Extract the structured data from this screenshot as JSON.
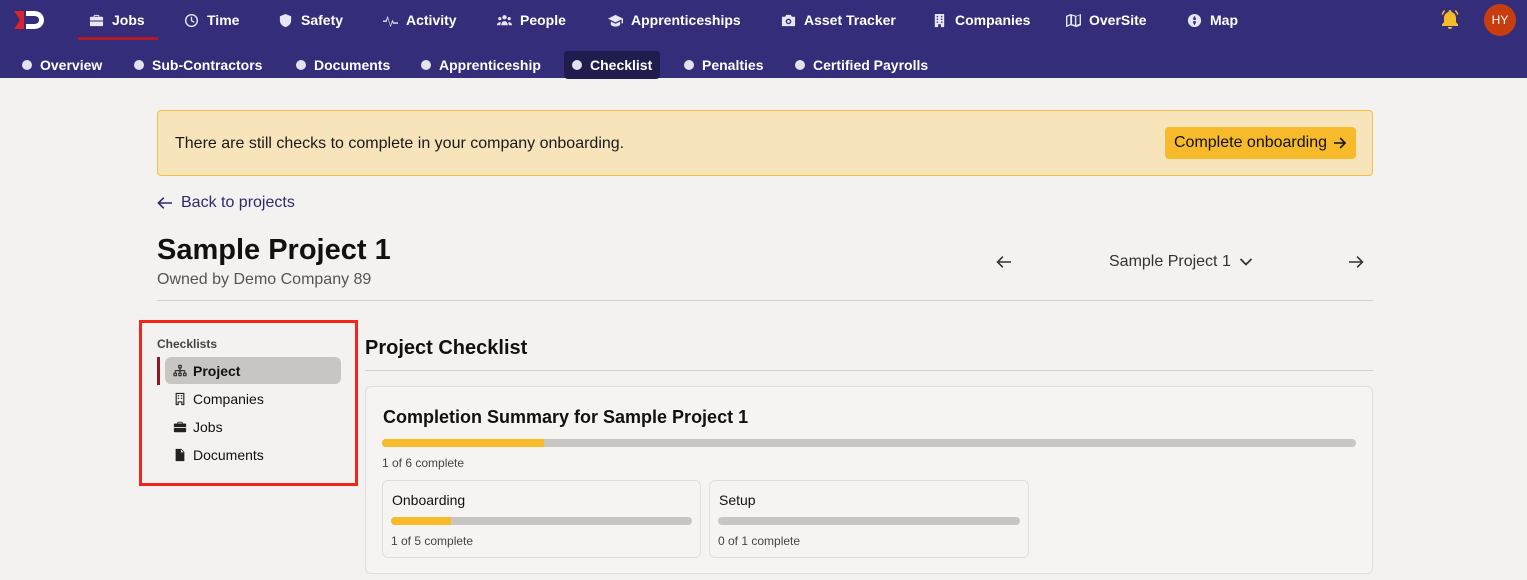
{
  "nav": {
    "items": [
      {
        "label": "Jobs",
        "icon": "briefcase-icon"
      },
      {
        "label": "Time",
        "icon": "clock-icon"
      },
      {
        "label": "Safety",
        "icon": "shield-icon"
      },
      {
        "label": "Activity",
        "icon": "pulse-icon"
      },
      {
        "label": "People",
        "icon": "people-icon"
      },
      {
        "label": "Apprenticeships",
        "icon": "graduation-cap-icon"
      },
      {
        "label": "Asset Tracker",
        "icon": "camera-icon"
      },
      {
        "label": "Companies",
        "icon": "building-icon"
      },
      {
        "label": "OverSite",
        "icon": "map-fold-icon"
      },
      {
        "label": "Map",
        "icon": "globe-icon"
      }
    ],
    "active": "Jobs",
    "avatar_initials": "HY"
  },
  "subnav": {
    "items": [
      {
        "label": "Overview"
      },
      {
        "label": "Sub-Contractors"
      },
      {
        "label": "Documents"
      },
      {
        "label": "Apprenticeship"
      },
      {
        "label": "Checklist"
      },
      {
        "label": "Penalties"
      },
      {
        "label": "Certified Payrolls"
      }
    ],
    "active": "Checklist"
  },
  "banner": {
    "text": "There are still checks to complete in your company onboarding.",
    "button_label": "Complete onboarding"
  },
  "back_link": "Back to projects",
  "project": {
    "title": "Sample Project 1",
    "owner": "Owned by Demo Company 89",
    "selector_value": "Sample Project 1"
  },
  "sidebar": {
    "heading": "Checklists",
    "items": [
      {
        "label": "Project",
        "icon": "sitemap-icon"
      },
      {
        "label": "Companies",
        "icon": "building-icon"
      },
      {
        "label": "Jobs",
        "icon": "briefcase-icon"
      },
      {
        "label": "Documents",
        "icon": "document-icon"
      }
    ],
    "active": "Project"
  },
  "main": {
    "section_title": "Project Checklist",
    "summary": {
      "title": "Completion Summary for Sample Project 1",
      "progress_fraction": 0.1667,
      "progress_text": "1 of 6 complete"
    },
    "subcards": [
      {
        "title": "Onboarding",
        "progress_fraction": 0.2,
        "progress_text": "1 of 5 complete"
      },
      {
        "title": "Setup",
        "progress_fraction": 0.0,
        "progress_text": "0 of 1 complete"
      }
    ]
  },
  "colors": {
    "nav_bg": "#332d7a",
    "accent": "#f6ba2a",
    "active_underline": "#b5182b",
    "highlight_box": "#f2251a"
  }
}
